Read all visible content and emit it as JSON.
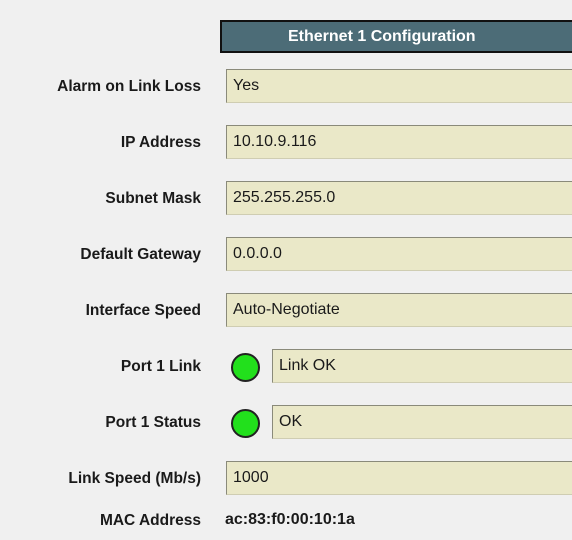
{
  "panel": {
    "title": "Ethernet 1 Configuration"
  },
  "fields": {
    "alarm_on_link_loss": {
      "label": "Alarm on Link Loss",
      "value": "Yes"
    },
    "ip_address": {
      "label": "IP Address",
      "value": "10.10.9.116"
    },
    "subnet_mask": {
      "label": "Subnet Mask",
      "value": "255.255.255.0"
    },
    "default_gateway": {
      "label": "Default Gateway",
      "value": "0.0.0.0"
    },
    "interface_speed": {
      "label": "Interface Speed",
      "value": "Auto-Negotiate"
    },
    "port1_link": {
      "label": "Port 1 Link",
      "value": "Link OK",
      "indicator_color": "#22e01c"
    },
    "port1_status": {
      "label": "Port 1 Status",
      "value": "OK",
      "indicator_color": "#22e01c"
    },
    "link_speed": {
      "label": "Link Speed (Mb/s)",
      "value": "1000"
    },
    "mac_address": {
      "label": "MAC Address",
      "value": "ac:83:f0:00:10:1a"
    }
  },
  "colors": {
    "header_bg": "#4c6c77",
    "field_bg": "#eae8c8",
    "indicator_ok": "#22e01c"
  }
}
